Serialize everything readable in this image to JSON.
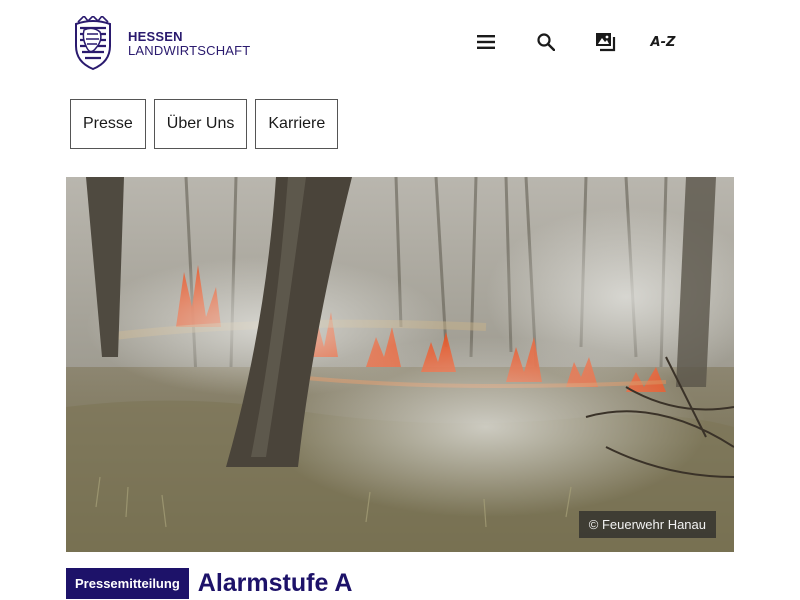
{
  "header": {
    "logo_line1": "HESSEN",
    "logo_line2": "LANDWIRTSCHAFT",
    "tools": {
      "menu_icon": "menu-icon",
      "search_icon": "search-icon",
      "easy_language_icon": "easy-language-icon",
      "az_label": "A-Z"
    }
  },
  "nav": {
    "items": [
      {
        "label": "Presse"
      },
      {
        "label": "Über Uns"
      },
      {
        "label": "Karriere"
      }
    ]
  },
  "hero": {
    "credit": "© Feuerwehr Hanau"
  },
  "article": {
    "badge": "Pressemitteilung",
    "title": "Alarmstufe A"
  },
  "colors": {
    "brand": "#1d1269",
    "logo_text": "#2a1a6e"
  }
}
